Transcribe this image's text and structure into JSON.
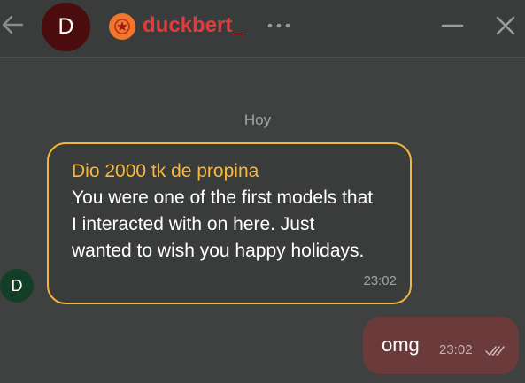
{
  "header": {
    "avatar_initial": "D",
    "username": "duckbert_",
    "icons": {
      "back": "arrow-left-icon",
      "badge": "star-badge-icon",
      "more": "more-dots-icon",
      "minimize": "minimize-icon",
      "close": "close-icon"
    }
  },
  "chat": {
    "date_separator": "Hoy",
    "incoming": {
      "avatar_initial": "D",
      "tip_label": "Dio 2000 tk de propina",
      "text": "You were one of the first models that I interacted with on here. Just wanted to wish you happy holidays.",
      "time": "23:02"
    },
    "outgoing": {
      "text": "omg",
      "time": "23:02",
      "status_icon": "double-check-icon"
    }
  },
  "colors": {
    "background": "#3f4040",
    "header_background": "#3a3b3b",
    "username": "#e23b3b",
    "tip_border": "#f2b73a",
    "tip_label": "#f7b93d",
    "outgoing_bubble": "#6b3a3a",
    "big_avatar": "#4a0c0c",
    "small_avatar": "#133f26",
    "badge": "#f2762c"
  }
}
